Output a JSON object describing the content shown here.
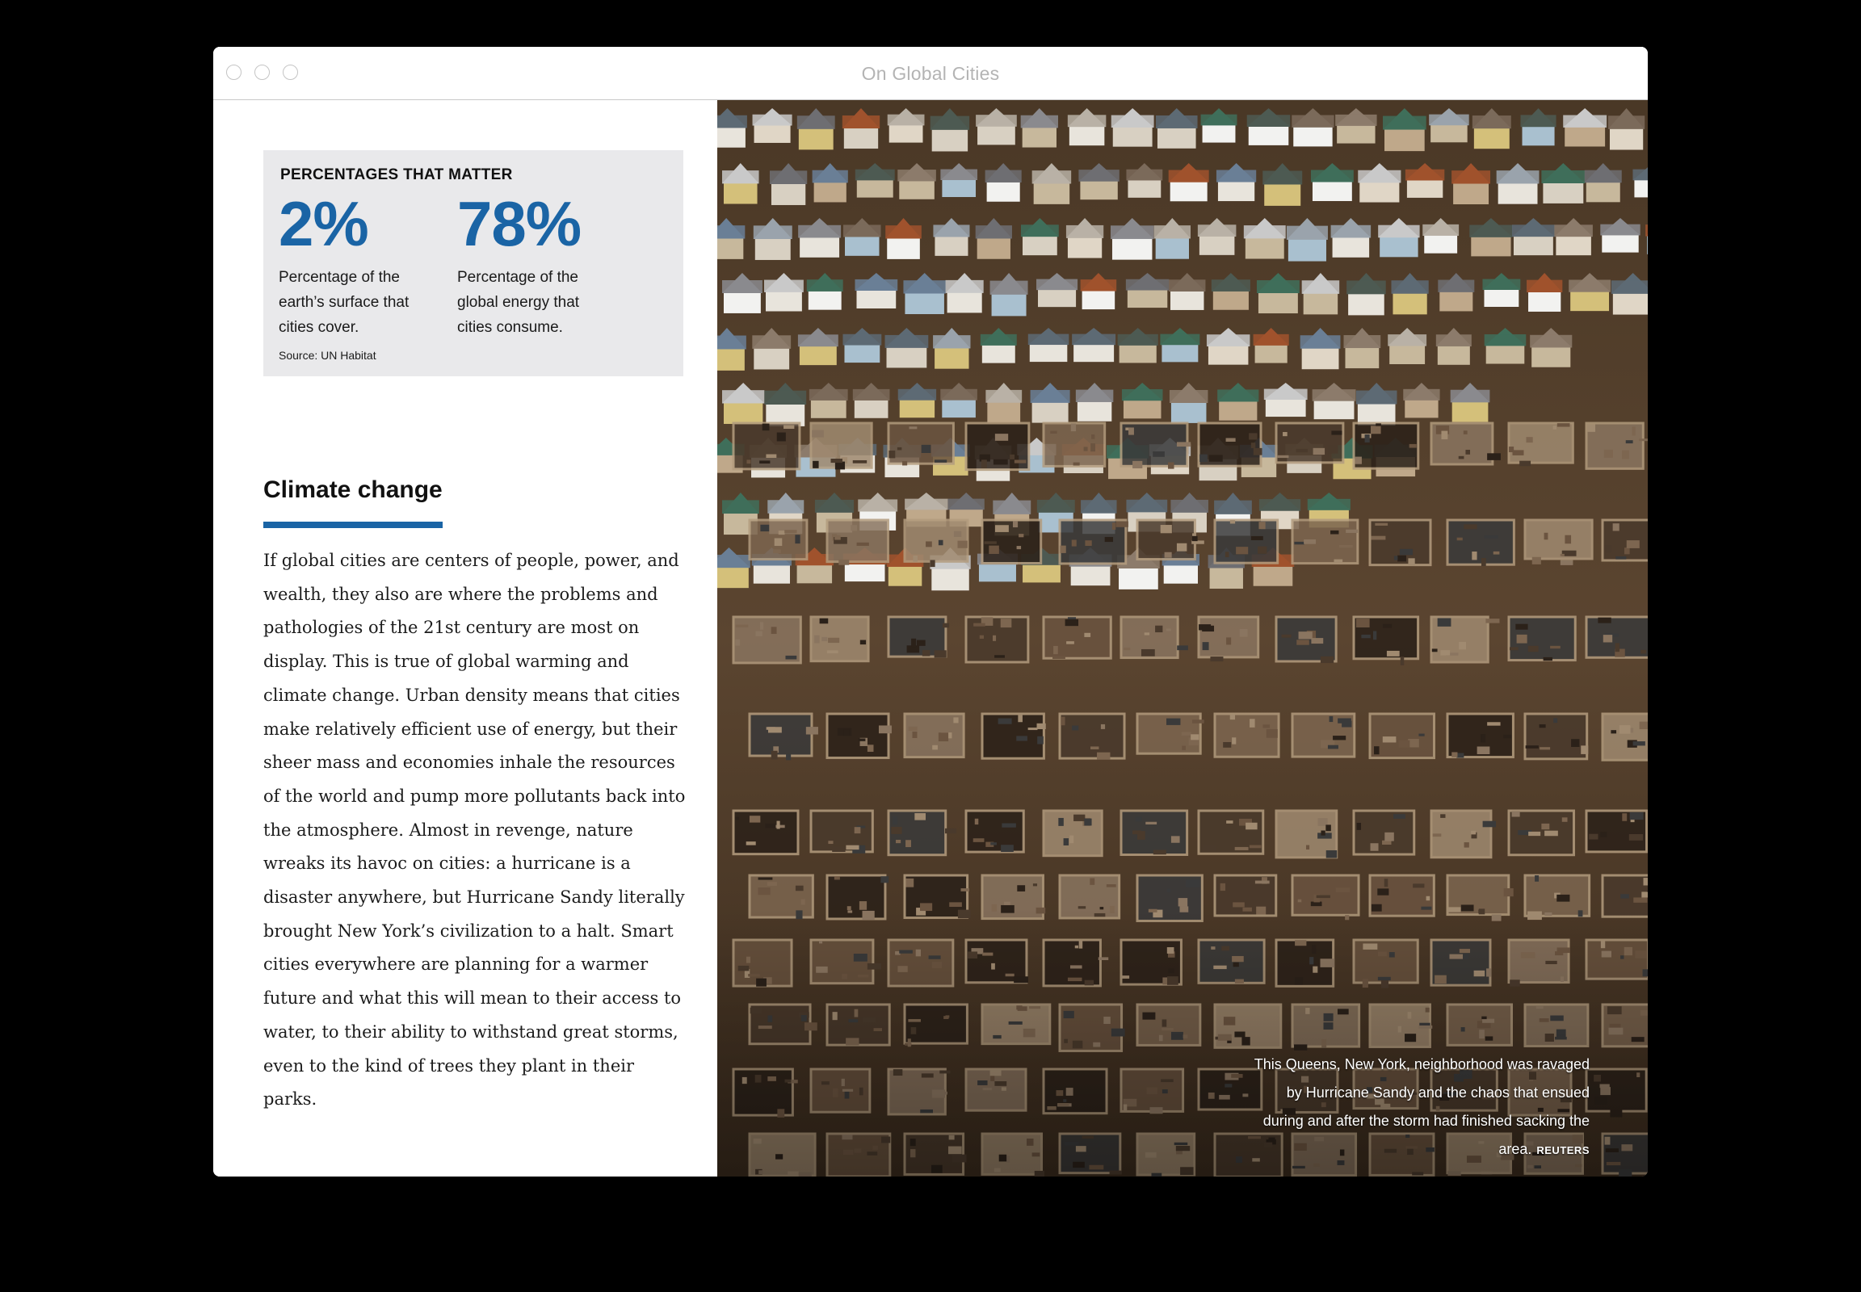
{
  "window": {
    "title": "On Global Cities"
  },
  "stats_box": {
    "heading": "PERCENTAGES THAT MATTER",
    "stats": [
      {
        "value": "2%",
        "description": "Percentage of the earth’s surface that cities cover."
      },
      {
        "value": "78%",
        "description": "Percentage of the global energy that cities consume."
      }
    ],
    "source": "Source: UN Habitat"
  },
  "section": {
    "heading": "Climate change",
    "body": "If global cities are centers of people, power, and wealth, they also are where the problems and pathologies of the 21st century are most on display. This is true of global warming and climate change. Urban density means that cities make relatively efficient use of energy, but their sheer mass and economies inhale the resources of the world and pump more pollutants back into the atmosphere. Almost in revenge, nature wreaks its havoc on cities: a hurricane is a disaster anywhere, but Hurricane Sandy literally brought New York’s civilization to a halt. Smart cities everywhere are planning for a warmer future and what this will mean to their access to water, to their ability to withstand great storms, even to the kind of trees they plant in their parks."
  },
  "photo": {
    "caption": "This Queens, New York, neighborhood was ravaged by Hurricane Sandy and the chaos that ensued during and after the storm had finished sacking the area.",
    "credit": "REUTERS"
  },
  "colors": {
    "accent": "#1a64a5",
    "stat_box_bg": "#e9e9eb"
  }
}
